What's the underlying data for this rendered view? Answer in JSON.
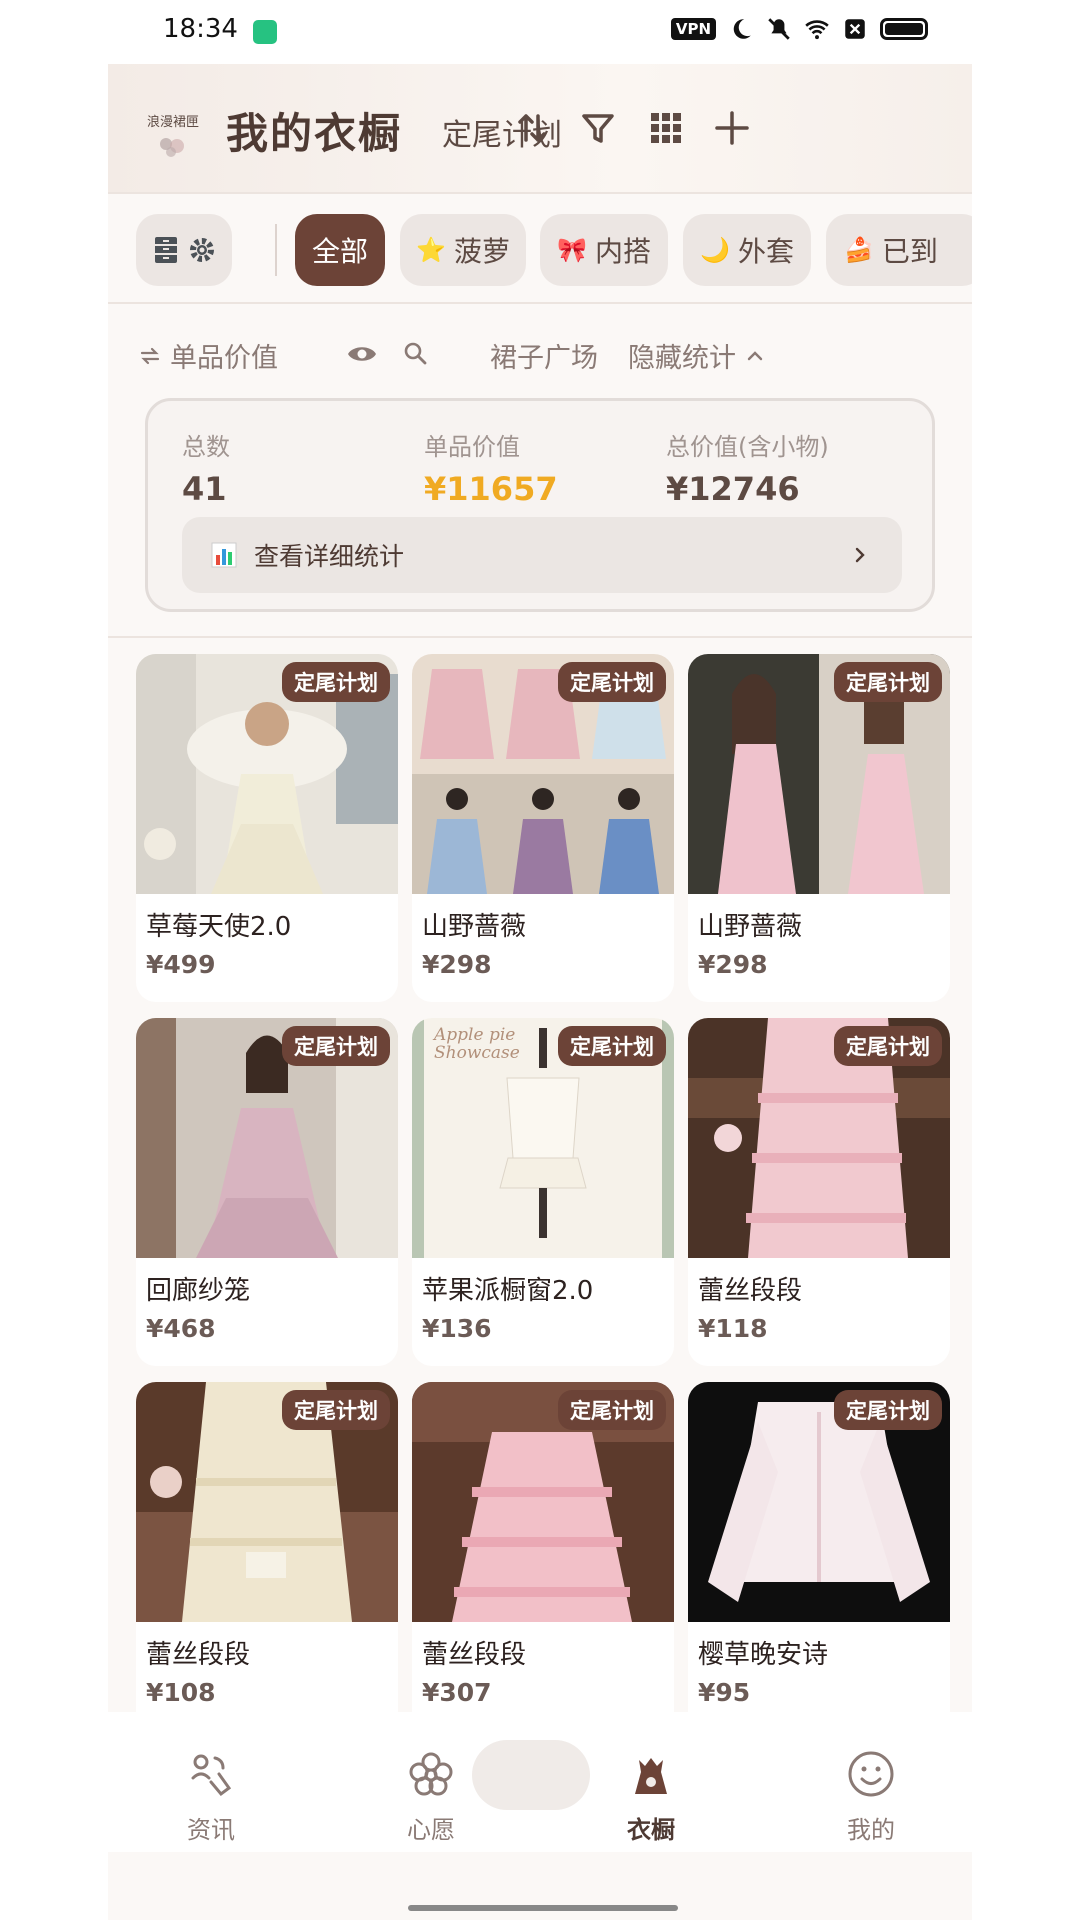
{
  "status_bar": {
    "time": "18:34",
    "vpn": "VPN"
  },
  "header": {
    "title": "我的衣橱",
    "subtitle": "定尾计划"
  },
  "chips": [
    {
      "label": "全部",
      "emoji": ""
    },
    {
      "label": "菠萝",
      "emoji": "⭐"
    },
    {
      "label": "内搭",
      "emoji": "🎀"
    },
    {
      "label": "外套",
      "emoji": "🌙"
    },
    {
      "label": "已到",
      "emoji": "🍰"
    }
  ],
  "stats_toolbar": {
    "sort_label": "单品价值",
    "plaza_label": "裙子广场",
    "hide_stats_label": "隐藏统计"
  },
  "stats": {
    "total_label": "总数",
    "total_value": "41",
    "item_value_label": "单品价值",
    "item_value": "¥11657",
    "total_value_label": "总价值(含小物)",
    "total_value_amount": "¥12746",
    "detail_label": "查看详细统计"
  },
  "items": [
    {
      "name": "草莓天使2.0",
      "price": "¥499",
      "badge": "定尾计划"
    },
    {
      "name": "山野蔷薇",
      "price": "¥298",
      "badge": "定尾计划"
    },
    {
      "name": "山野蔷薇",
      "price": "¥298",
      "badge": "定尾计划"
    },
    {
      "name": "回廊纱笼",
      "price": "¥468",
      "badge": "定尾计划"
    },
    {
      "name": "苹果派橱窗2.0",
      "price": "¥136",
      "badge": "定尾计划"
    },
    {
      "name": "蕾丝段段",
      "price": "¥118",
      "badge": "定尾计划"
    },
    {
      "name": "蕾丝段段",
      "price": "¥108",
      "badge": "定尾计划"
    },
    {
      "name": "蕾丝段段",
      "price": "¥307",
      "badge": "定尾计划"
    },
    {
      "name": "樱草晚安诗",
      "price": "¥95",
      "badge": "定尾计划"
    }
  ],
  "bottom_nav": [
    {
      "label": "资讯"
    },
    {
      "label": "心愿"
    },
    {
      "label": "衣橱"
    },
    {
      "label": "我的"
    }
  ],
  "colors": {
    "accent": "#6c4337",
    "gold": "#f0aa22"
  }
}
